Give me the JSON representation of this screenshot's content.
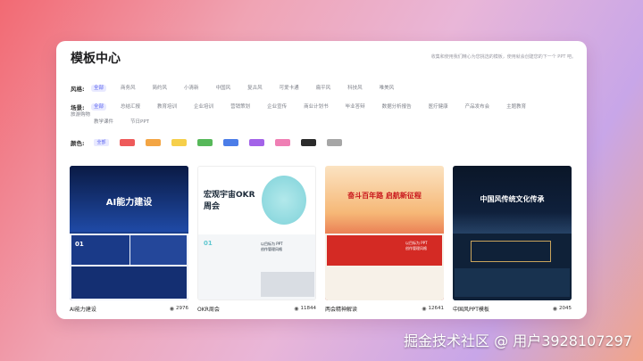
{
  "header": {
    "title": "模板中心",
    "description": "收集和使用我们精心为您挑选的模板，使用就会创建您的下一个 PPT 吧。"
  },
  "filters": {
    "style": {
      "label": "风格:",
      "options": [
        "全部",
        "商务风",
        "简约风",
        "小清新",
        "中国风",
        "复古风",
        "可爱卡通",
        "扁平风",
        "科技风",
        "唯美风"
      ]
    },
    "scene": {
      "label": "场景:",
      "options": [
        "全部",
        "总结汇报",
        "教育培训",
        "企业培训",
        "营销策划",
        "企业宣传",
        "商业计划书",
        "毕业答辩",
        "数据分析报告",
        "医疗健康",
        "产品发布会",
        "主题教育",
        "旅游购物"
      ],
      "options_row2": [
        "教学课件",
        "节日PPT"
      ]
    },
    "color": {
      "label": "颜色:",
      "all_label": "全部",
      "swatches": [
        "#ee5a5a",
        "#f3a544",
        "#f6cf4a",
        "#57b85a",
        "#4b7de8",
        "#a363e8",
        "#ef7fb4",
        "#2b2b2b",
        "#a6a6a6"
      ]
    }
  },
  "templates": [
    {
      "name": "AI能力建设",
      "views": "2976",
      "thumb_title": "AI能力建设",
      "thumb_num": "01",
      "colors": {
        "bg": "#0f2a66",
        "accent": "#3a6ef0"
      }
    },
    {
      "name": "OKR周会",
      "views": "11844",
      "thumb_title": "宏观宇宙OKR\n周会",
      "thumb_num": "01",
      "tag": "以目标为 PPT\n创作管理风格",
      "colors": {
        "bg": "#ffffff",
        "accent": "#5fc7d0"
      }
    },
    {
      "name": "两会精神解读",
      "views": "12641",
      "thumb_title": "奋斗百年路 启航新征程",
      "tag": "以目标为 PPT\n创作管理风格",
      "colors": {
        "bg": "#c8141a",
        "accent": "#f7d36a"
      }
    },
    {
      "name": "中国风PPT模板",
      "views": "2045",
      "thumb_title": "中国风传统文化传承",
      "colors": {
        "bg": "#0d1e36",
        "accent": "#c9a45c"
      }
    }
  ],
  "watermark": "掘金技术社区 @ 用户3928107297"
}
